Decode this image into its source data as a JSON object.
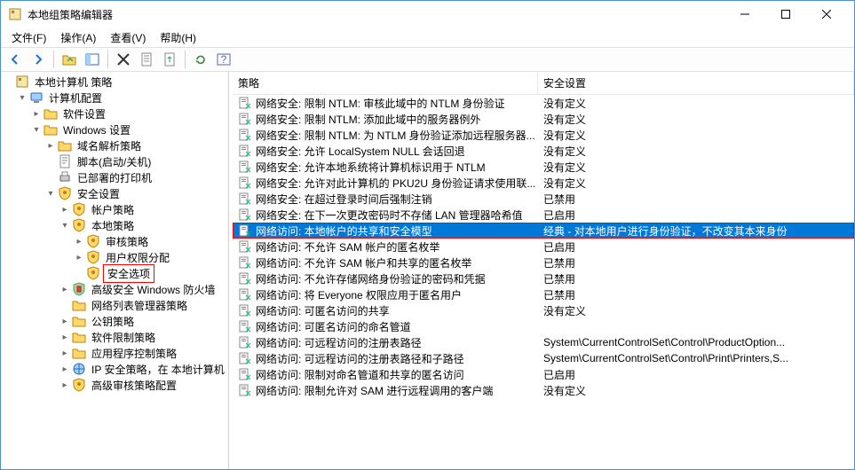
{
  "window": {
    "title": "本地组策略编辑器"
  },
  "menus": {
    "file": "文件(F)",
    "action": "操作(A)",
    "view": "查看(V)",
    "help": "帮助(H)"
  },
  "columns": {
    "policy": "策略",
    "setting": "安全设置"
  },
  "tree": [
    {
      "d": 0,
      "t": "",
      "i": "root",
      "l": "本地计算机 策略"
    },
    {
      "d": 1,
      "t": "▾",
      "i": "pc",
      "l": "计算机配置"
    },
    {
      "d": 2,
      "t": "▸",
      "i": "fld",
      "l": "软件设置"
    },
    {
      "d": 2,
      "t": "▾",
      "i": "fld",
      "l": "Windows 设置"
    },
    {
      "d": 3,
      "t": "▸",
      "i": "fld",
      "l": "域名解析策略"
    },
    {
      "d": 3,
      "t": "",
      "i": "script",
      "l": "脚本(启动/关机)"
    },
    {
      "d": 3,
      "t": "",
      "i": "printer",
      "l": "已部署的打印机"
    },
    {
      "d": 3,
      "t": "▾",
      "i": "sec",
      "l": "安全设置"
    },
    {
      "d": 4,
      "t": "▸",
      "i": "acct",
      "l": "帐户策略"
    },
    {
      "d": 4,
      "t": "▾",
      "i": "local",
      "l": "本地策略"
    },
    {
      "d": 5,
      "t": "▸",
      "i": "audit",
      "l": "审核策略"
    },
    {
      "d": 5,
      "t": "▸",
      "i": "rights",
      "l": "用户权限分配"
    },
    {
      "d": 5,
      "t": "",
      "i": "opts",
      "l": "安全选项",
      "sel": true
    },
    {
      "d": 4,
      "t": "▸",
      "i": "fw",
      "l": "高级安全 Windows 防火墙"
    },
    {
      "d": 4,
      "t": "",
      "i": "netlist",
      "l": "网络列表管理器策略"
    },
    {
      "d": 4,
      "t": "▸",
      "i": "pk",
      "l": "公钥策略"
    },
    {
      "d": 4,
      "t": "▸",
      "i": "swr",
      "l": "软件限制策略"
    },
    {
      "d": 4,
      "t": "▸",
      "i": "appctl",
      "l": "应用程序控制策略"
    },
    {
      "d": 4,
      "t": "▸",
      "i": "ipsec",
      "l": "IP 安全策略，在 本地计算机"
    },
    {
      "d": 4,
      "t": "▸",
      "i": "advaudit",
      "l": "高级审核策略配置"
    }
  ],
  "rows": [
    {
      "p": "网络安全: 限制 NTLM: 审核此域中的 NTLM 身份验证",
      "s": "没有定义"
    },
    {
      "p": "网络安全: 限制 NTLM: 添加此域中的服务器例外",
      "s": "没有定义"
    },
    {
      "p": "网络安全: 限制 NTLM: 为 NTLM 身份验证添加远程服务器...",
      "s": "没有定义"
    },
    {
      "p": "网络安全: 允许 LocalSystem NULL 会话回退",
      "s": "没有定义"
    },
    {
      "p": "网络安全: 允许本地系统将计算机标识用于 NTLM",
      "s": "没有定义"
    },
    {
      "p": "网络安全: 允许对此计算机的 PKU2U 身份验证请求使用联...",
      "s": "没有定义"
    },
    {
      "p": "网络安全: 在超过登录时间后强制注销",
      "s": "已禁用"
    },
    {
      "p": "网络安全: 在下一次更改密码时不存储 LAN 管理器哈希值",
      "s": "已启用"
    },
    {
      "p": "网络访问: 本地帐户的共享和安全模型",
      "s": "经典 - 对本地用户进行身份验证，不改变其本来身份",
      "sel": true
    },
    {
      "p": "网络访问: 不允许 SAM 帐户的匿名枚举",
      "s": "已启用"
    },
    {
      "p": "网络访问: 不允许 SAM 帐户和共享的匿名枚举",
      "s": "已禁用"
    },
    {
      "p": "网络访问: 不允许存储网络身份验证的密码和凭据",
      "s": "已禁用"
    },
    {
      "p": "网络访问: 将 Everyone 权限应用于匿名用户",
      "s": "已禁用"
    },
    {
      "p": "网络访问: 可匿名访问的共享",
      "s": "没有定义"
    },
    {
      "p": "网络访问: 可匿名访问的命名管道",
      "s": ""
    },
    {
      "p": "网络访问: 可远程访问的注册表路径",
      "s": "System\\CurrentControlSet\\Control\\ProductOption..."
    },
    {
      "p": "网络访问: 可远程访问的注册表路径和子路径",
      "s": "System\\CurrentControlSet\\Control\\Print\\Printers,S..."
    },
    {
      "p": "网络访问: 限制对命名管道和共享的匿名访问",
      "s": "已启用"
    },
    {
      "p": "网络访问: 限制允许对 SAM 进行远程调用的客户端",
      "s": "没有定义"
    }
  ]
}
